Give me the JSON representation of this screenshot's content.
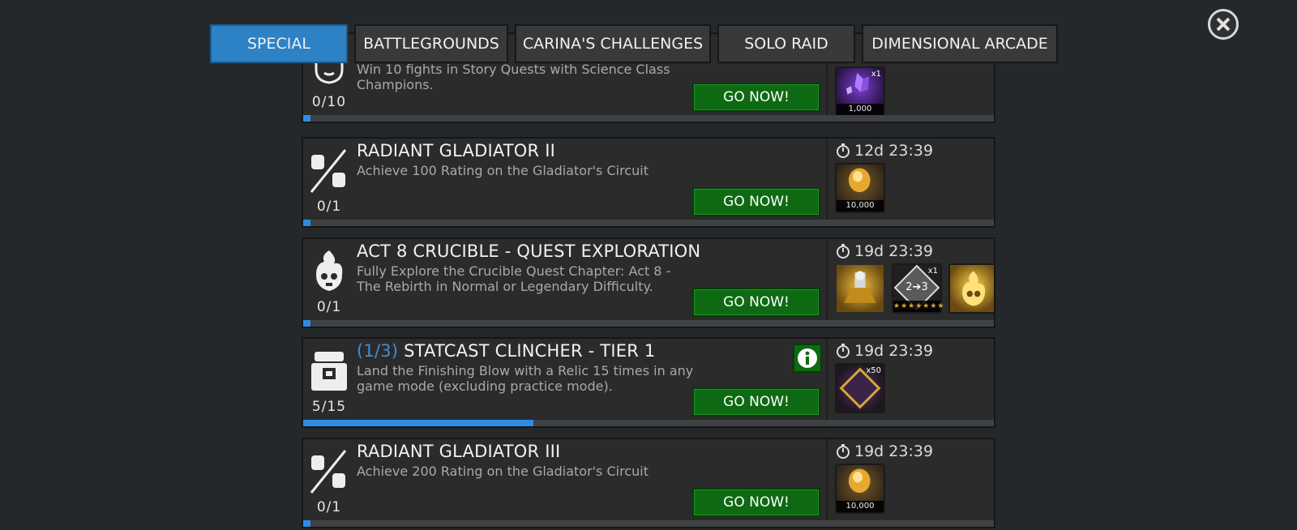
{
  "tabs": [
    {
      "label": "SPECIAL",
      "active": true
    },
    {
      "label": "BATTLEGROUNDS",
      "active": false
    },
    {
      "label": "CARINA'S CHALLENGES",
      "active": false
    },
    {
      "label": "SOLO RAID",
      "active": false
    },
    {
      "label": "DIMENSIONAL ARCADE",
      "active": false
    }
  ],
  "close_icon": "close-icon",
  "quests": [
    {
      "icon": "science-class-icon",
      "title": "",
      "description": "Win 10 fights in Story Quests with Science Class Champions.",
      "progress": "0/10",
      "progress_fraction": 0.0,
      "button": "GO NOW!",
      "timer": "",
      "rewards": [
        {
          "name": "crystal-shards",
          "quantity": "1,000",
          "multiplier": "x1"
        }
      ]
    },
    {
      "icon": "gladiator-versus-icon",
      "title": "RADIANT GLADIATOR II",
      "description": "Achieve 100 Rating on the Gladiator's Circuit",
      "progress": "0/1",
      "progress_fraction": 0.0,
      "button": "GO NOW!",
      "timer": "12d 23:39",
      "rewards": [
        {
          "name": "gold-gem",
          "quantity": "10,000",
          "multiplier": ""
        }
      ]
    },
    {
      "icon": "flaming-skull-icon",
      "title": "ACT 8 CRUCIBLE - QUEST EXPLORATION",
      "description": "Fully Explore the Crucible Quest Chapter: Act 8 - The Rebirth in Normal or Legendary Difficulty.",
      "progress": "0/1",
      "progress_fraction": 0.0,
      "button": "GO NOW!",
      "timer": "19d 23:39",
      "rewards": [
        {
          "name": "champion-crystal",
          "quantity": "",
          "multiplier": ""
        },
        {
          "name": "rank-up-2-3",
          "quantity": "",
          "multiplier": "x1",
          "text": "2➔3"
        },
        {
          "name": "skull-crystal",
          "quantity": "",
          "multiplier": ""
        }
      ]
    },
    {
      "icon": "relic-chest-icon",
      "tier": "(1/3)",
      "title": "STATCAST CLINCHER - TIER 1",
      "description": "Land the Finishing Blow with a Relic 15 times in any game mode (excluding practice mode).",
      "progress": "5/15",
      "progress_fraction": 0.3333,
      "button": "GO NOW!",
      "info_icon": "info-icon",
      "timer": "19d 23:39",
      "rewards": [
        {
          "name": "event-points",
          "quantity": "",
          "multiplier": "x50"
        }
      ]
    },
    {
      "icon": "gladiator-versus-icon",
      "title": "RADIANT GLADIATOR III",
      "description": "Achieve 200 Rating on the Gladiator's Circuit",
      "progress": "0/1",
      "progress_fraction": 0.0,
      "button": "GO NOW!",
      "timer": "19d 23:39",
      "rewards": [
        {
          "name": "gold-gem",
          "quantity": "10,000",
          "multiplier": ""
        }
      ]
    }
  ],
  "colors": {
    "background": "#25282b",
    "tab_active": "#2d82c6",
    "button_green": "#0e6a12",
    "progress_blue": "#2e8ce6",
    "tier_blue": "#3f8fd6"
  }
}
